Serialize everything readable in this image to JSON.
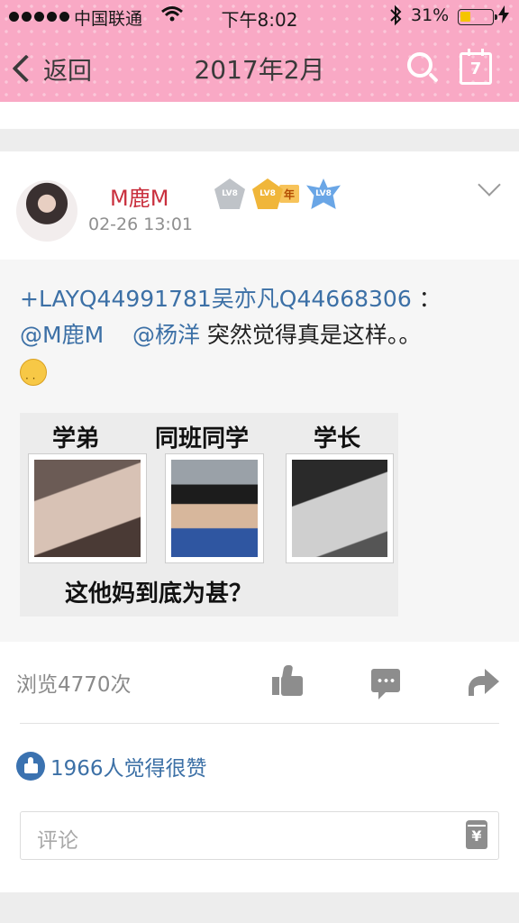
{
  "status_bar": {
    "carrier": "中国联通",
    "time": "下午8:02",
    "battery_percent": "31%",
    "battery_level": 0.31
  },
  "nav": {
    "back_label": "返回",
    "title": "2017年2月",
    "calendar_day": "7"
  },
  "post": {
    "author": "M鹿M",
    "time": "02-26 13:01",
    "badges": [
      "LV8",
      "LV8",
      "年",
      "LV8"
    ],
    "text": {
      "hashtag": "+LAYQ44991781吴亦凡Q44668306",
      "colon": " ：",
      "mention1": "@M鹿M",
      "mention2": "@杨洋",
      "body": " 突然觉得真是这样。。",
      "emoji": "thinking-face-emoji"
    },
    "image": {
      "labels": [
        "学弟",
        "同班同学",
        "学长"
      ],
      "caption": "这他妈到底为甚？"
    },
    "views": "浏览4770次",
    "likes_text": "1966人觉得很赞",
    "comment_placeholder": "评论",
    "gift_symbol": "¥"
  },
  "colors": {
    "header_pink": "#f9a9c5",
    "author_red": "#c9303e",
    "link_blue": "#3c70a6"
  }
}
